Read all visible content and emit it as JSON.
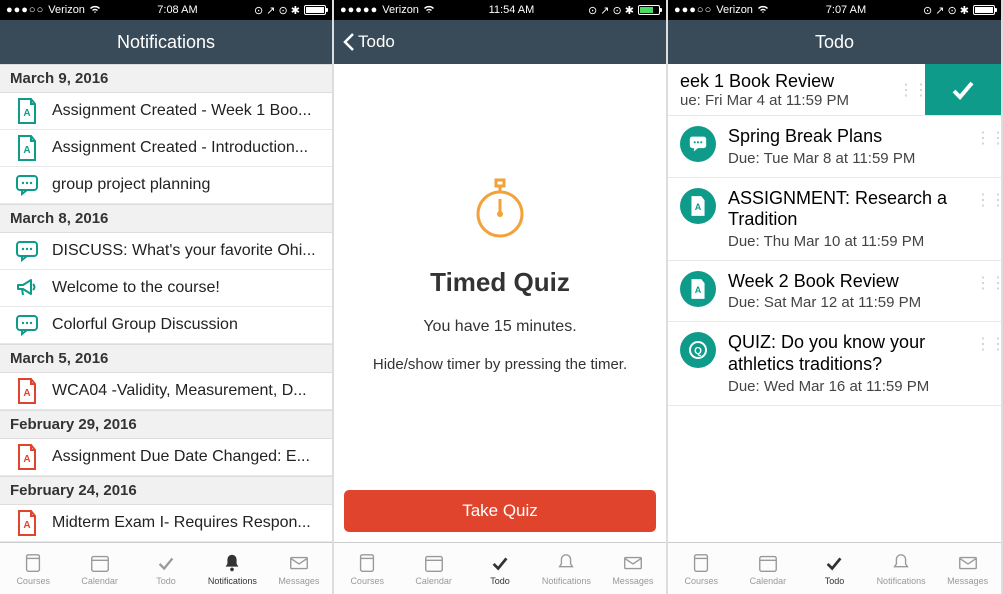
{
  "screen1": {
    "status": {
      "carrier": "Verizon",
      "time": "7:08 AM"
    },
    "title": "Notifications",
    "sections": [
      {
        "date": "March 9, 2016",
        "items": [
          {
            "icon": "assignment",
            "color": "#0E9B8A",
            "text": "Assignment Created - Week 1 Boo..."
          },
          {
            "icon": "assignment",
            "color": "#0E9B8A",
            "text": "Assignment Created - Introduction..."
          },
          {
            "icon": "discussion",
            "color": "#0E9B8A",
            "text": "group project planning"
          }
        ]
      },
      {
        "date": "March 8, 2016",
        "items": [
          {
            "icon": "discussion",
            "color": "#0E9B8A",
            "text": "DISCUSS: What's your favorite Ohi..."
          },
          {
            "icon": "announcement",
            "color": "#0E9B8A",
            "text": "Welcome to the course!"
          },
          {
            "icon": "discussion",
            "color": "#0E9B8A",
            "text": "Colorful Group Discussion"
          }
        ]
      },
      {
        "date": "March 5, 2016",
        "items": [
          {
            "icon": "assignment",
            "color": "#E0442C",
            "text": "WCA04 -Validity, Measurement, D..."
          }
        ]
      },
      {
        "date": "February 29, 2016",
        "items": [
          {
            "icon": "assignment",
            "color": "#E0442C",
            "text": "Assignment Due Date Changed: E..."
          }
        ]
      },
      {
        "date": "February 24, 2016",
        "items": [
          {
            "icon": "assignment",
            "color": "#E0442C",
            "text": "Midterm Exam I- Requires Respon..."
          }
        ]
      }
    ],
    "tabs": [
      "Courses",
      "Calendar",
      "Todo",
      "Notifications",
      "Messages"
    ],
    "activeTab": "Notifications"
  },
  "screen2": {
    "status": {
      "carrier": "Verizon",
      "time": "11:54 AM"
    },
    "backLabel": "Todo",
    "quizTitle": "Timed Quiz",
    "quizSub": "You have 15 minutes.",
    "quizHint": "Hide/show timer by pressing the timer.",
    "button": "Take Quiz",
    "tabs": [
      "Courses",
      "Calendar",
      "Todo",
      "Notifications",
      "Messages"
    ],
    "activeTab": "Todo"
  },
  "screen3": {
    "status": {
      "carrier": "Verizon",
      "time": "7:07 AM"
    },
    "title": "Todo",
    "swiped": {
      "title": "eek 1 Book Review",
      "due": "ue: Fri Mar 4 at 11:59 PM"
    },
    "items": [
      {
        "icon": "discussion",
        "title": "Spring Break Plans",
        "due": "Due: Tue Mar 8 at 11:59 PM"
      },
      {
        "icon": "assignment",
        "title": "ASSIGNMENT: Research a Tradition",
        "due": "Due: Thu Mar 10 at 11:59 PM"
      },
      {
        "icon": "assignment",
        "title": "Week 2 Book Review",
        "due": "Due: Sat Mar 12 at 11:59 PM"
      },
      {
        "icon": "quiz",
        "title": "QUIZ: Do you know your athletics traditions?",
        "due": "Due: Wed Mar 16 at 11:59 PM"
      }
    ],
    "tabs": [
      "Courses",
      "Calendar",
      "Todo",
      "Notifications",
      "Messages"
    ],
    "activeTab": "Todo"
  }
}
